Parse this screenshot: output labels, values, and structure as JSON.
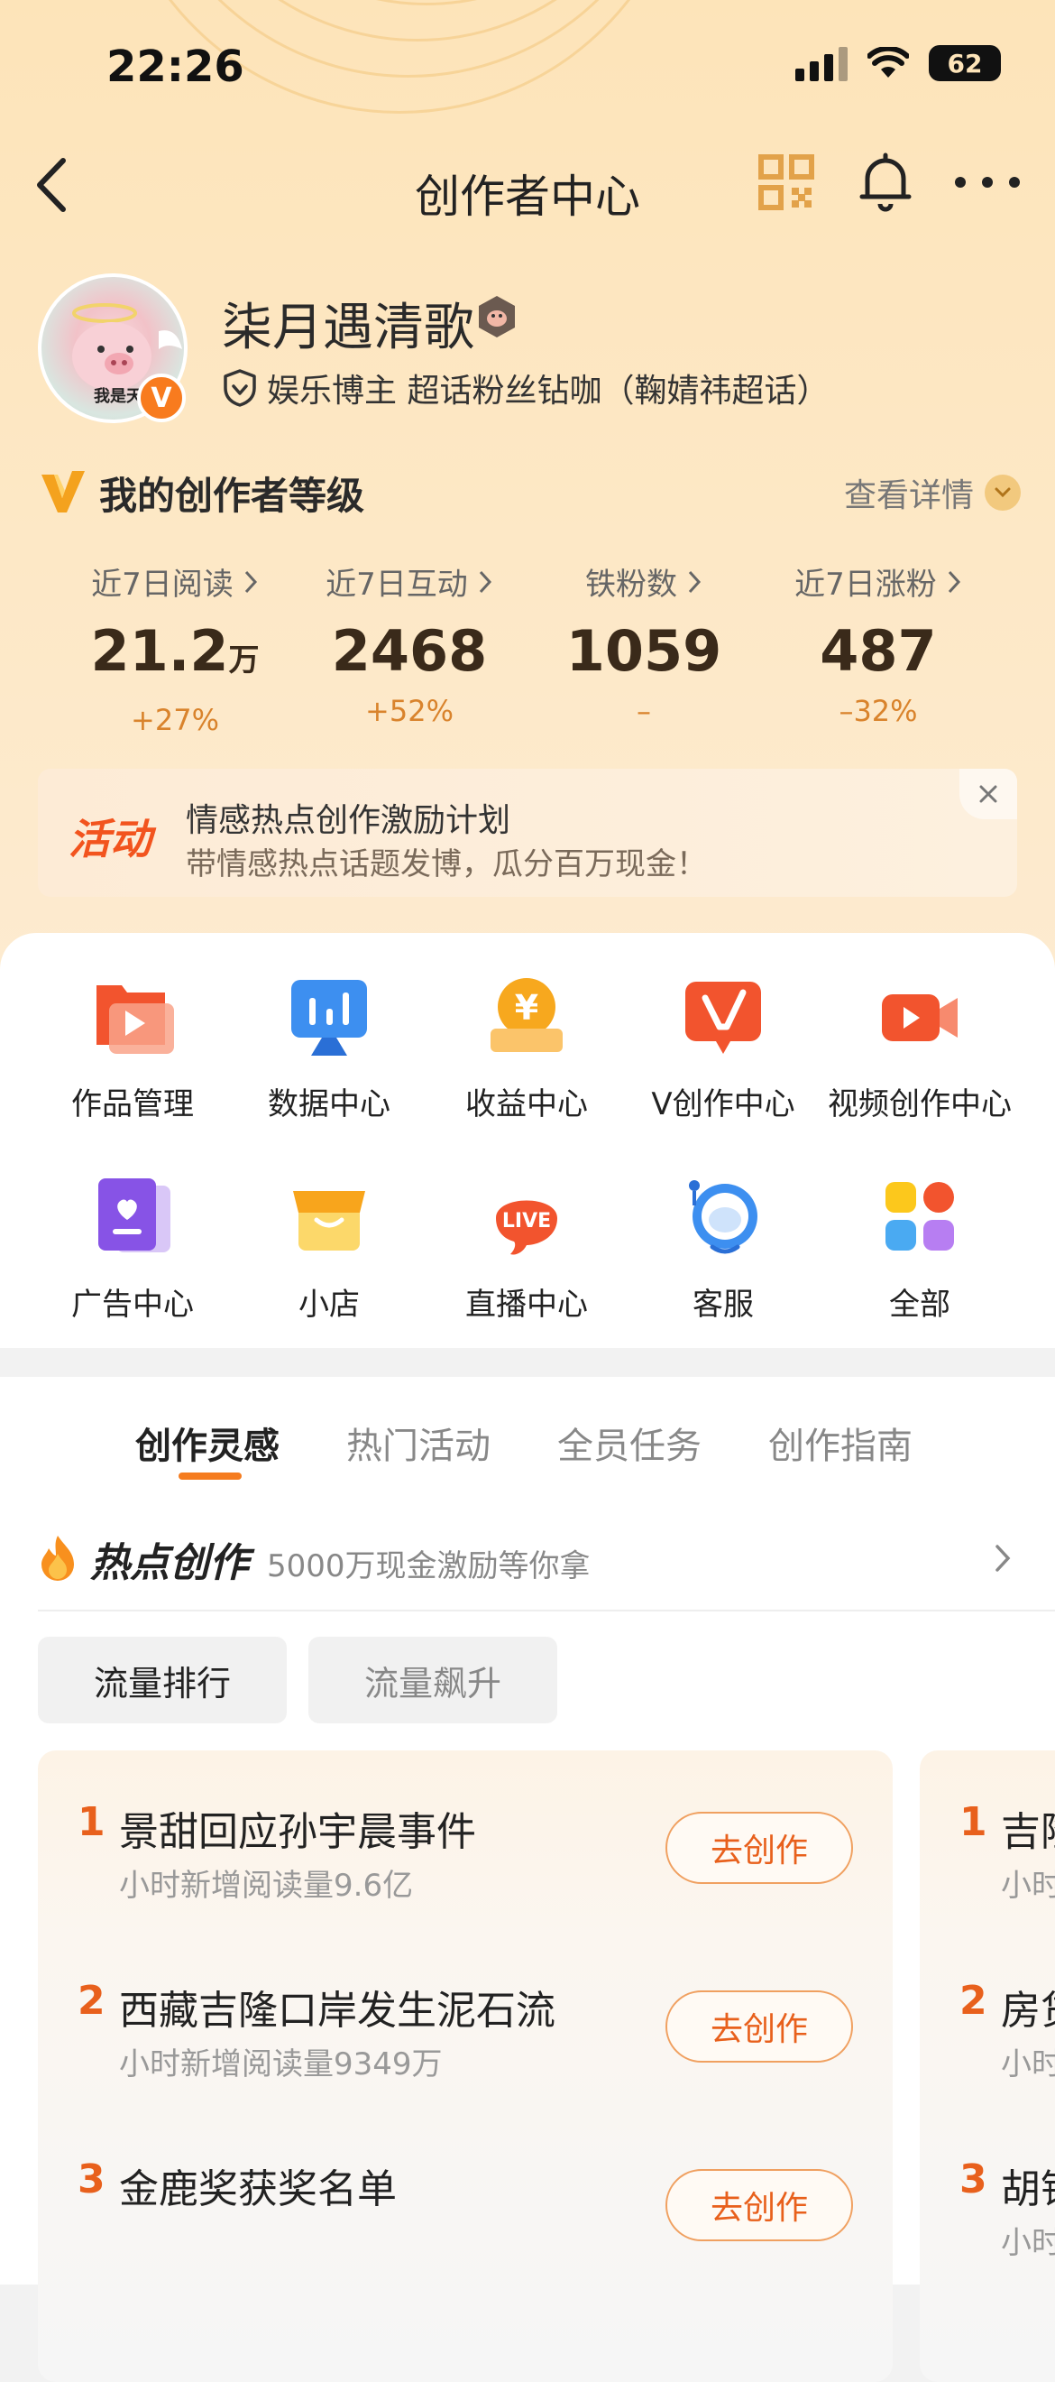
{
  "status_bar": {
    "time": "22:26",
    "battery": "62"
  },
  "nav": {
    "title": "创作者中心"
  },
  "profile": {
    "avatar_caption": "我是天",
    "username": "柒月遇清歌",
    "verify_badge": "V",
    "subtitle": "娱乐博主 超话粉丝钻咖（鞠婧祎超话）"
  },
  "level": {
    "title": "我的创作者等级",
    "more": "查看详情"
  },
  "stats": [
    {
      "label": "近7日阅读",
      "value": "21.2",
      "unit": "万",
      "change": "+27%"
    },
    {
      "label": "近7日互动",
      "value": "2468",
      "unit": "",
      "change": "+52%"
    },
    {
      "label": "铁粉数",
      "value": "1059",
      "unit": "",
      "change": "–"
    },
    {
      "label": "近7日涨粉",
      "value": "487",
      "unit": "",
      "change": "–32%"
    }
  ],
  "banner": {
    "tag": "活动",
    "title": "情感热点创作激励计划",
    "subtitle": "带情感热点话题发博，瓜分百万现金！"
  },
  "grid": [
    {
      "label": "作品管理",
      "icon": "works-icon"
    },
    {
      "label": "数据中心",
      "icon": "data-icon"
    },
    {
      "label": "收益中心",
      "icon": "income-icon"
    },
    {
      "label": "V创作中心",
      "icon": "v-create-icon"
    },
    {
      "label": "视频创作中心",
      "icon": "video-icon"
    },
    {
      "label": "广告中心",
      "icon": "ad-icon"
    },
    {
      "label": "小店",
      "icon": "shop-icon"
    },
    {
      "label": "直播中心",
      "icon": "live-icon"
    },
    {
      "label": "客服",
      "icon": "service-icon"
    },
    {
      "label": "全部",
      "icon": "all-icon"
    }
  ],
  "tabs": [
    "创作灵感",
    "热门活动",
    "全员任务",
    "创作指南"
  ],
  "hot": {
    "title": "热点创作",
    "subtitle": "5000万现金激励等你拿"
  },
  "chips": [
    "流量排行",
    "流量飙升"
  ],
  "ranking": [
    {
      "rank": "1",
      "title": "景甜回应孙宇晨事件",
      "sub": "小时新增阅读量9.6亿",
      "btn": "去创作"
    },
    {
      "rank": "2",
      "title": "西藏吉隆口岸发生泥石流",
      "sub": "小时新增阅读量9349万",
      "btn": "去创作"
    },
    {
      "rank": "3",
      "title": "金鹿奖获奖名单",
      "sub": "",
      "btn": "去创作"
    }
  ],
  "ranking2": [
    {
      "rank": "1",
      "title": "吉隆",
      "sub": "小时"
    },
    {
      "rank": "2",
      "title": "房贷",
      "sub": "小时"
    },
    {
      "rank": "3",
      "title": "胡锡",
      "sub": "小时"
    }
  ]
}
